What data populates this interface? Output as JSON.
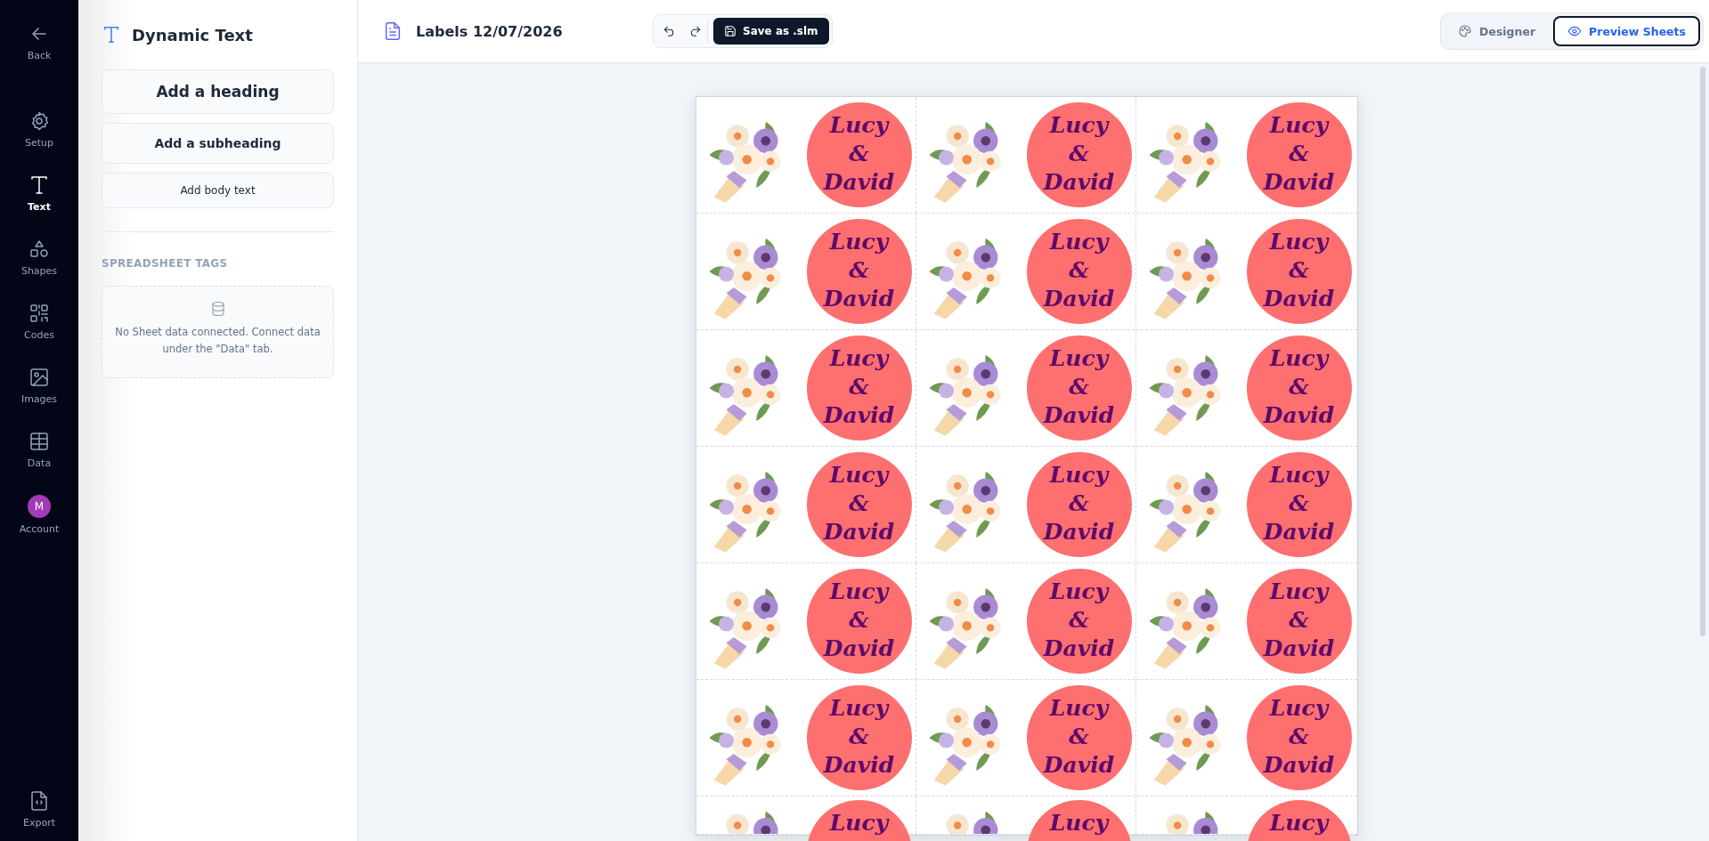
{
  "nav": {
    "items": [
      {
        "kind": "back",
        "label": "Back",
        "selected": false
      },
      {
        "kind": "setup",
        "label": "Setup",
        "selected": false
      },
      {
        "kind": "text",
        "label": "Text",
        "selected": true
      },
      {
        "kind": "shapes",
        "label": "Shapes",
        "selected": false
      },
      {
        "kind": "codes",
        "label": "Codes",
        "selected": false
      },
      {
        "kind": "images",
        "label": "Images",
        "selected": false
      },
      {
        "kind": "data",
        "label": "Data",
        "selected": false
      },
      {
        "kind": "account",
        "label": "Account",
        "selected": false,
        "avatar": "M"
      }
    ],
    "bottom": {
      "kind": "export",
      "label": "Export",
      "selected": false
    }
  },
  "panel": {
    "title": "Dynamic Text",
    "buttons": [
      {
        "kind": "heading",
        "label": "Add a heading"
      },
      {
        "kind": "subheading",
        "label": "Add a subheading"
      },
      {
        "kind": "body",
        "label": "Add body text"
      }
    ],
    "section_title": "SPREADSHEET TAGS",
    "empty_message": "No Sheet data connected. Connect data under the \"Data\" tab."
  },
  "toolbar": {
    "document_title": "Labels 12/07/2026",
    "save_label": "Save as .slm",
    "modes": [
      {
        "kind": "designer",
        "label": "Designer",
        "selected": false
      },
      {
        "kind": "preview",
        "label": "Preview Sheets",
        "selected": true
      }
    ]
  },
  "sheet": {
    "rows": [
      [
        [
          "Lucy",
          "&",
          "David"
        ],
        [
          "Lucy",
          "&",
          "David"
        ],
        [
          "Lucy",
          "&",
          "David"
        ]
      ],
      [
        [
          "Lucy",
          "&",
          "David"
        ],
        [
          "Lucy",
          "&",
          "David"
        ],
        [
          "Lucy",
          "&",
          "David"
        ]
      ],
      [
        [
          "Lucy",
          "&",
          "David"
        ],
        [
          "Lucy",
          "&",
          "David"
        ],
        [
          "Lucy",
          "&",
          "David"
        ]
      ],
      [
        [
          "Lucy",
          "&",
          "David"
        ],
        [
          "Lucy",
          "&",
          "David"
        ],
        [
          "Lucy",
          "&",
          "David"
        ]
      ],
      [
        [
          "Lucy",
          "&",
          "David"
        ],
        [
          "Lucy",
          "&",
          "David"
        ],
        [
          "Lucy",
          "&",
          "David"
        ]
      ],
      [
        [
          "Lucy",
          "&",
          "David"
        ],
        [
          "Lucy",
          "&",
          "David"
        ],
        [
          "Lucy",
          "&",
          "David"
        ]
      ],
      [
        [
          "Lucy"
        ],
        [
          "Lucy"
        ],
        [
          "Lucy"
        ]
      ]
    ]
  }
}
